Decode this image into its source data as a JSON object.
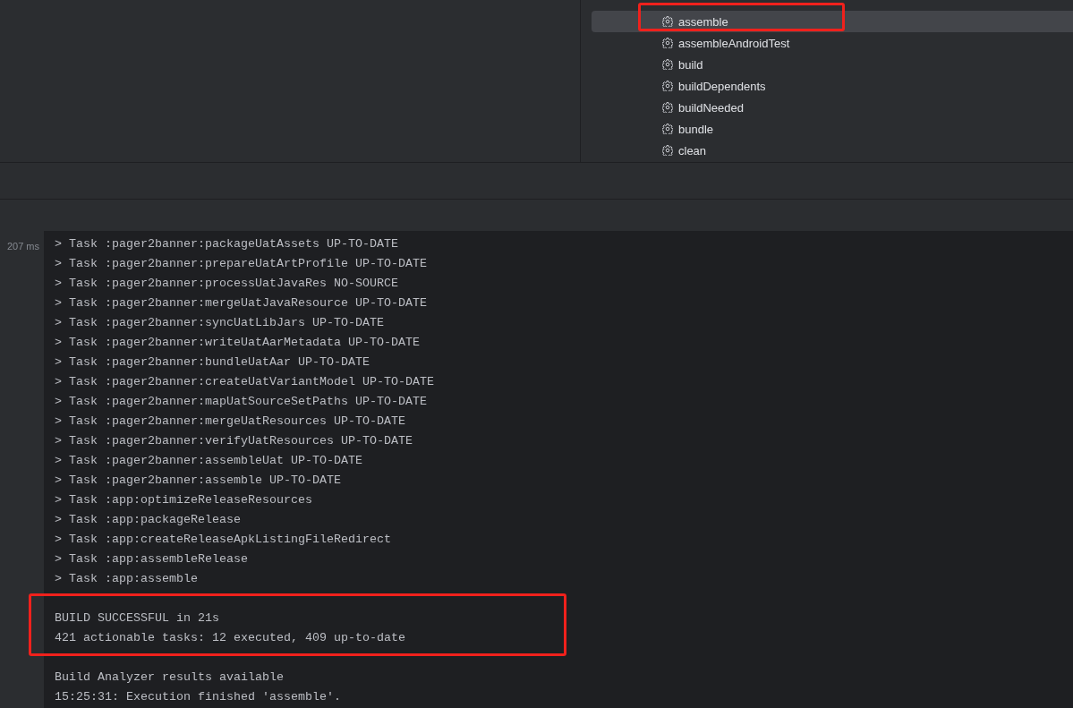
{
  "gradle_panel": {
    "tasks": [
      {
        "label": "assemble",
        "selected": true,
        "highlighted": true
      },
      {
        "label": "assembleAndroidTest",
        "selected": false,
        "highlighted": false
      },
      {
        "label": "build",
        "selected": false,
        "highlighted": false
      },
      {
        "label": "buildDependents",
        "selected": false,
        "highlighted": false
      },
      {
        "label": "buildNeeded",
        "selected": false,
        "highlighted": false
      },
      {
        "label": "bundle",
        "selected": false,
        "highlighted": false
      },
      {
        "label": "clean",
        "selected": false,
        "highlighted": false
      }
    ]
  },
  "console": {
    "gutter_time": "207 ms",
    "task_lines": [
      "> Task :pager2banner:packageUatAssets UP-TO-DATE",
      "> Task :pager2banner:prepareUatArtProfile UP-TO-DATE",
      "> Task :pager2banner:processUatJavaRes NO-SOURCE",
      "> Task :pager2banner:mergeUatJavaResource UP-TO-DATE",
      "> Task :pager2banner:syncUatLibJars UP-TO-DATE",
      "> Task :pager2banner:writeUatAarMetadata UP-TO-DATE",
      "> Task :pager2banner:bundleUatAar UP-TO-DATE",
      "> Task :pager2banner:createUatVariantModel UP-TO-DATE",
      "> Task :pager2banner:mapUatSourceSetPaths UP-TO-DATE",
      "> Task :pager2banner:mergeUatResources UP-TO-DATE",
      "> Task :pager2banner:verifyUatResources UP-TO-DATE",
      "> Task :pager2banner:assembleUat UP-TO-DATE",
      "> Task :pager2banner:assemble UP-TO-DATE",
      "> Task :app:optimizeReleaseResources",
      "> Task :app:packageRelease",
      "> Task :app:createReleaseApkListingFileRedirect",
      "> Task :app:assembleRelease",
      "> Task :app:assemble"
    ],
    "summary": {
      "highlighted": true,
      "lines": [
        "BUILD SUCCESSFUL in 21s",
        "421 actionable tasks: 12 executed, 409 up-to-date"
      ]
    },
    "footer_lines": [
      "Build Analyzer results available",
      "15:25:31: Execution finished 'assemble'."
    ]
  }
}
